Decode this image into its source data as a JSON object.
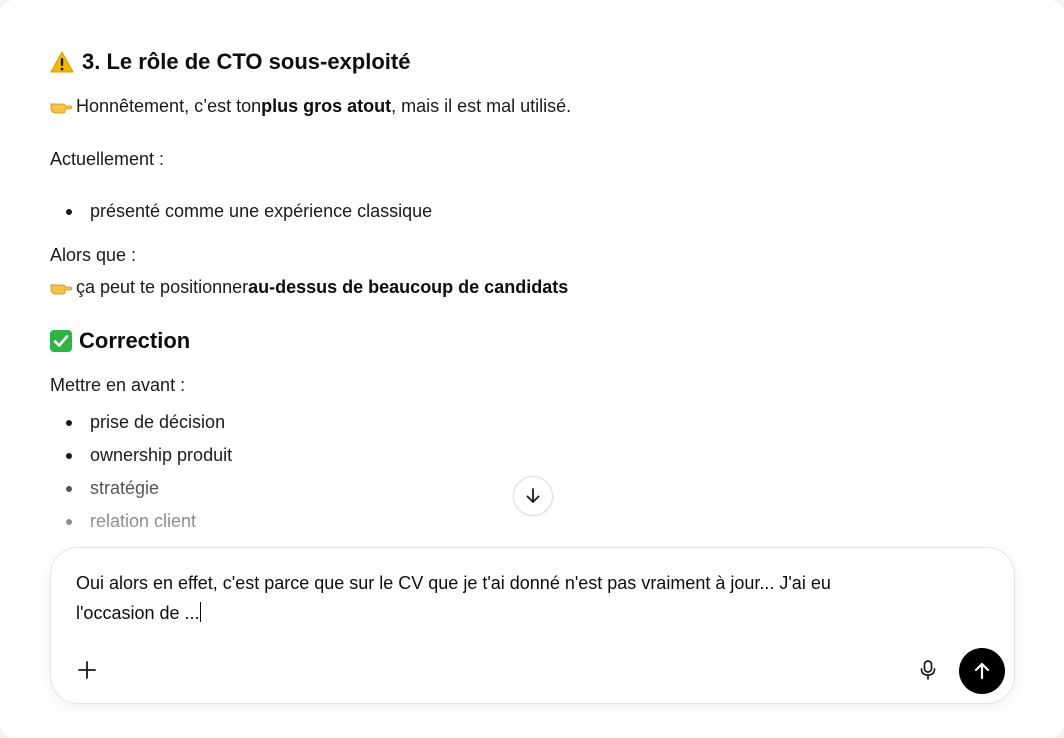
{
  "section3": {
    "heading": "3. Le rôle de CTO sous-exploité",
    "intro_before": "Honnêtement, c’est ton ",
    "intro_bold": "plus gros atout",
    "intro_after": ", mais il est mal utilisé.",
    "current_label": "Actuellement :",
    "current_items": [
      "présenté comme une expérience classique"
    ],
    "whereas_label": "Alors que :",
    "whereas_before": "ça peut te positionner ",
    "whereas_bold": "au-dessus de beaucoup de candidats"
  },
  "correction": {
    "heading": "Correction",
    "label": "Mettre en avant :",
    "items": [
      "prise de décision",
      "ownership produit",
      "stratégie",
      "relation client"
    ]
  },
  "composer": {
    "text": "Oui alors en effet, c'est parce que sur le CV que je t'ai donné n'est pas vraiment à jour... J'ai eu\nl'occasion de ..."
  },
  "icons": {
    "heading_warning": "warning-icon",
    "heading_check": "check-mark-icon",
    "pointer": "pointing-hand-icon",
    "scroll_down": "arrow-down-icon",
    "add": "plus-icon",
    "dictate": "microphone-icon",
    "send": "arrow-up-icon"
  },
  "colors": {
    "send_button": "#000000",
    "check_badge": "#2fb344",
    "warning_triangle": "#f5b800"
  }
}
